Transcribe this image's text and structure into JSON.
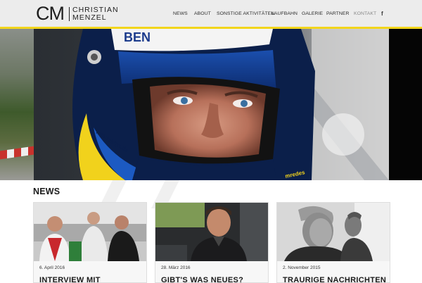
{
  "brand": {
    "monogram": "CM",
    "first_name": "CHRISTIAN",
    "last_name": "MENZEL",
    "accent_color": "#f2d51b"
  },
  "nav": {
    "items": [
      {
        "label": "NEWS"
      },
      {
        "label": "ABOUT"
      },
      {
        "label": "SONSTIGE AKTIVITÄTEN"
      },
      {
        "label": "LAUFBAHN"
      },
      {
        "label": "GALERIE"
      },
      {
        "label": "PARTNER"
      },
      {
        "label": "KONTAKT",
        "active": true
      }
    ],
    "social_icon": "facebook-icon",
    "social_glyph": "f"
  },
  "hero": {
    "image": "driver-helmet-closeup",
    "helmet_text": "BEN",
    "visor_sticker": "mredesign.de",
    "chin_text": "mredes"
  },
  "news": {
    "title": "NEWS",
    "cards": [
      {
        "date": "6. April 2016",
        "headline": "INTERVIEW MIT",
        "image": "team-conversation-photo"
      },
      {
        "date": "28. März 2016",
        "headline": "GIBT'S WAS NEUES?",
        "image": "driver-in-car-photo"
      },
      {
        "date": "2. November 2015",
        "headline": "TRAURIGE NACHRICHTEN",
        "image": "black-white-portrait-photo"
      }
    ]
  }
}
